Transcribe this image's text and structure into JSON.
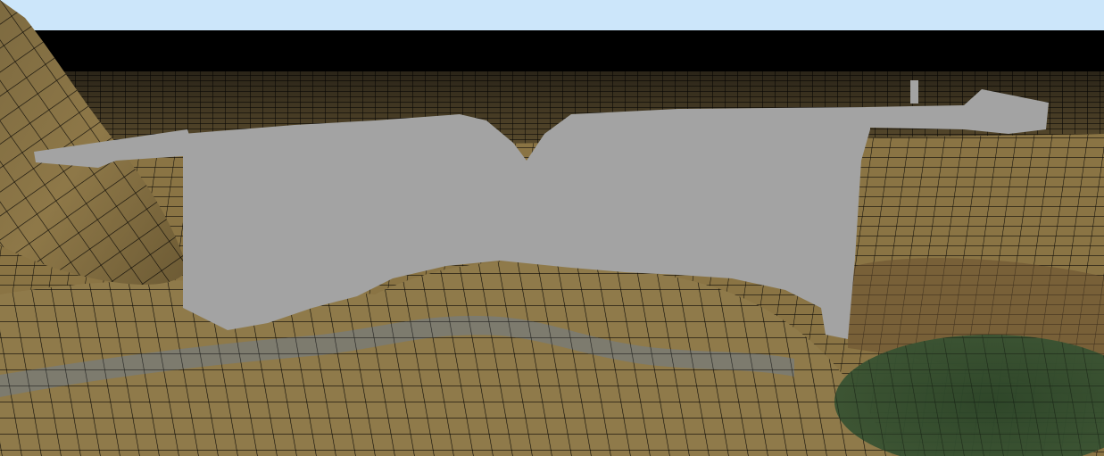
{
  "scene": {
    "sky_color": "#cce6fa",
    "horizon_band_color": "#000000",
    "terrain_base_color": "#8a7444",
    "terrain_dark_color": "#5e4c2a",
    "terrain_light_color": "#a38c58",
    "wireframe_color": "#000000",
    "road_color": "#7b7b72",
    "grass_patch_color": "#2f4a2c",
    "building_color": "#a3a3a3"
  }
}
